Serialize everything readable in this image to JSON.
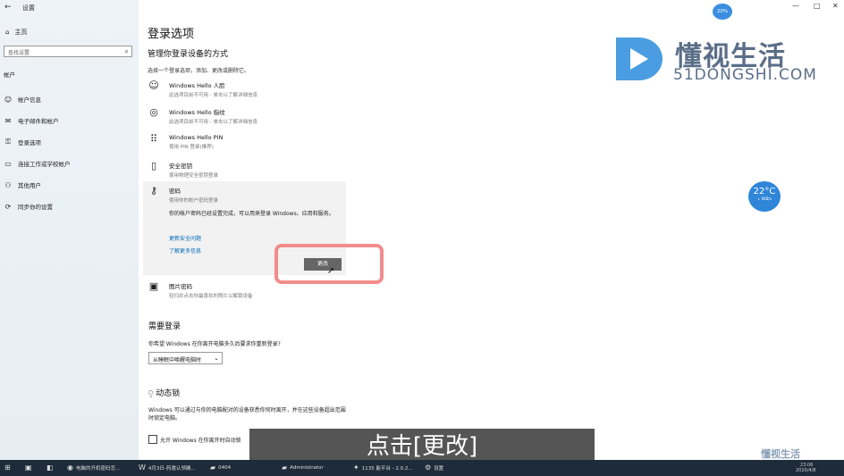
{
  "window": {
    "title": "设置",
    "back": "←",
    "controls": [
      "—",
      "□",
      "✕"
    ]
  },
  "sidebar": {
    "home": "主页",
    "search_placeholder": "查找设置",
    "section": "帐户",
    "items": [
      {
        "label": "帐户信息",
        "icon": "user-icon"
      },
      {
        "label": "电子邮件和帐户",
        "icon": "mail-icon"
      },
      {
        "label": "登录选项",
        "icon": "key-icon"
      },
      {
        "label": "连接工作或学校帐户",
        "icon": "briefcase-icon"
      },
      {
        "label": "其他用户",
        "icon": "people-icon"
      },
      {
        "label": "同步你的设置",
        "icon": "sync-icon"
      }
    ]
  },
  "main": {
    "title": "登录选项",
    "subtitle": "管理你登录设备的方式",
    "hint": "选择一个登录选项，添加、更改或删除它。",
    "options": [
      {
        "title": "Windows Hello 人脸",
        "desc": "此选项目前不可用 - 单击以了解详细信息",
        "icon": "face-icon"
      },
      {
        "title": "Windows Hello 指纹",
        "desc": "此选项目前不可用 - 单击以了解详细信息",
        "icon": "fingerprint-icon"
      },
      {
        "title": "Windows Hello PIN",
        "desc": "使用 PIN 登录(推荐)",
        "icon": "pin-icon"
      },
      {
        "title": "安全密钥",
        "desc": "使用物理安全密钥登录",
        "icon": "usb-key-icon"
      },
      {
        "title": "密码",
        "desc": "使用你的帐户密码登录",
        "icon": "password-key-icon"
      }
    ],
    "password_panel": {
      "desc": "你的帐户密码已经设置完成，可以用来登录 Windows、应用和服务。",
      "link1": "更新安全问题",
      "link2": "了解更多信息",
      "change_button": "更改"
    },
    "picture_password": {
      "title": "图片密码",
      "desc": "轻扫并点击你最喜欢的照片以解锁设备",
      "icon": "picture-icon"
    },
    "require_signin": {
      "heading": "需要登录",
      "question": "你希望 Windows 在你离开电脑多久后要求你重新登录?",
      "dropdown": "从睡眠中唤醒电脑时"
    },
    "dynamic_lock": {
      "heading": "动态锁",
      "desc": "Windows 可以通过与你的电脑配对的设备获悉你何时离开，并在这些设备超出范围时锁定电脑。",
      "checkbox": "允许 Windows 在你离开时自动锁"
    }
  },
  "overlay": {
    "brand": "懂视生活",
    "brand_url": "51DONGSHI.COM",
    "top_bubble": "20%",
    "weather_temp": "22°C",
    "weather_sub": "↓ 0KB/s",
    "caption": "点击[更改]",
    "bottom_watermark": "懂视生活"
  },
  "taskbar": {
    "items": [
      {
        "label": "电脑的开机密码怎...",
        "icon": "browser-icon"
      },
      {
        "label": "4月3日-药邀认领确...",
        "icon": "word-icon"
      },
      {
        "label": "0404",
        "icon": "folder-icon"
      },
      {
        "label": "Administrator",
        "icon": "folder-icon"
      },
      {
        "label": "1135 能平台 - 2.0.2...",
        "icon": "app-icon"
      },
      {
        "label": "设置",
        "icon": "gear-icon"
      }
    ],
    "time": "23:06",
    "date": "2020/4/8"
  }
}
